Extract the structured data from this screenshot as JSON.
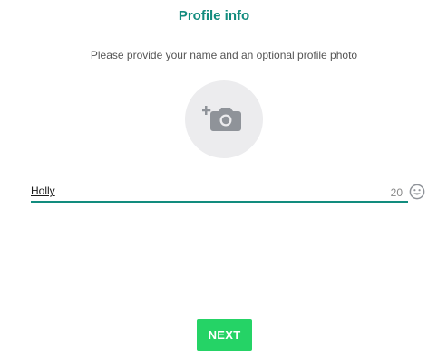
{
  "header": {
    "title": "Profile info",
    "subtitle": "Please provide your name and an optional profile photo"
  },
  "profile_photo": {
    "icon": "add-camera-icon"
  },
  "name_field": {
    "value": "Holly",
    "remaining_chars": "20"
  },
  "emoji_button": {
    "icon": "smiley-icon"
  },
  "next_button": {
    "label": "NEXT"
  },
  "colors": {
    "title": "#128c7e",
    "underline": "#128c7e",
    "next_button_bg": "#25d366",
    "avatar_bg": "#ececee",
    "icon_grey": "#8f9399"
  }
}
